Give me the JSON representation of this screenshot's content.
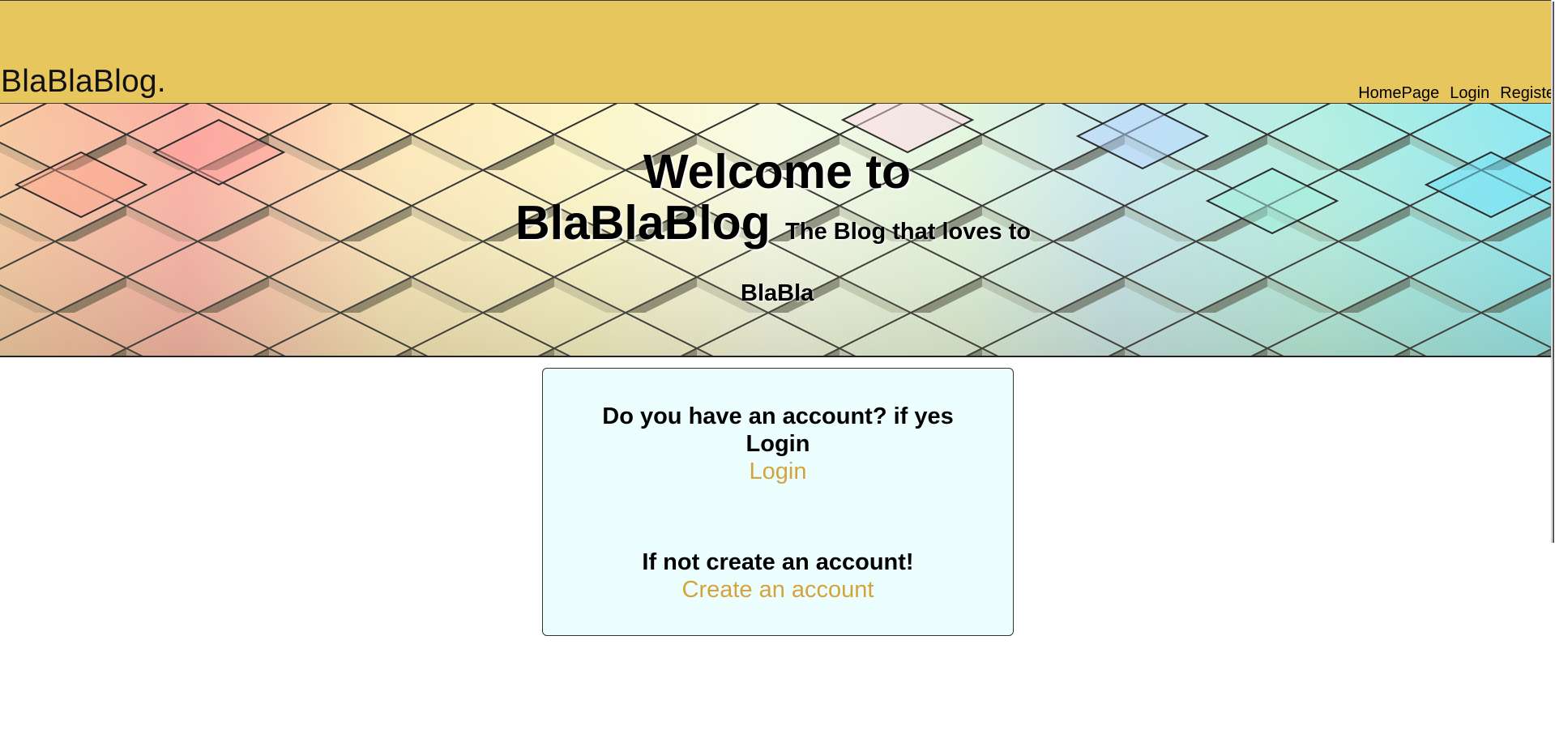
{
  "header": {
    "logo_text": "BlaBlaBlog.",
    "nav": [
      {
        "label": "HomePage"
      },
      {
        "label": "Login"
      },
      {
        "label": "Registe"
      }
    ],
    "background_color": "#e8c65e"
  },
  "hero": {
    "title_line1": "Welcome to",
    "title_line2": "BlaBlaBlog",
    "tagline_part1": "The Blog that loves to",
    "tagline_part2": "BlaBla"
  },
  "card": {
    "login_question": "Do you have an account? if yes",
    "login_heading": "Login",
    "login_link": "Login",
    "register_question": "If not create an account!",
    "register_link": "Create an account",
    "background_color": "#ecfffe",
    "link_color": "#d4a43c"
  }
}
